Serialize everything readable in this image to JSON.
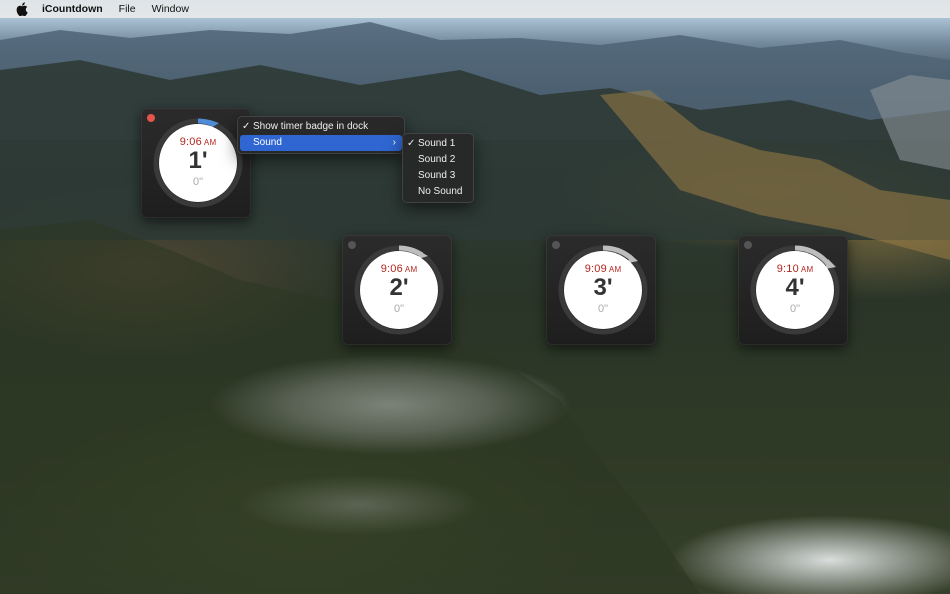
{
  "menubar": {
    "app_name": "iCountdown",
    "items": [
      "File",
      "Window"
    ]
  },
  "timers": [
    {
      "time": "9:06",
      "ampm": "AM",
      "minutes": "1'",
      "seconds": "0\"",
      "active": true
    },
    {
      "time": "9:06",
      "ampm": "AM",
      "minutes": "2'",
      "seconds": "0\"",
      "active": false
    },
    {
      "time": "9:09",
      "ampm": "AM",
      "minutes": "3'",
      "seconds": "0\"",
      "active": false
    },
    {
      "time": "9:10",
      "ampm": "AM",
      "minutes": "4'",
      "seconds": "0\"",
      "active": false
    }
  ],
  "context_menu": {
    "items": [
      {
        "label": "Show timer badge in dock",
        "checked": true
      },
      {
        "label": "Sound",
        "selected": true,
        "submenu": true
      }
    ]
  },
  "sound_submenu": {
    "items": [
      {
        "label": "Sound 1",
        "checked": true
      },
      {
        "label": "Sound 2",
        "checked": false
      },
      {
        "label": "Sound 3",
        "checked": false
      },
      {
        "label": "No Sound",
        "checked": false
      }
    ]
  },
  "colors": {
    "time_red": "#b3261e",
    "menu_highlight": "#2f66d1",
    "close_button": "#e5554c"
  }
}
